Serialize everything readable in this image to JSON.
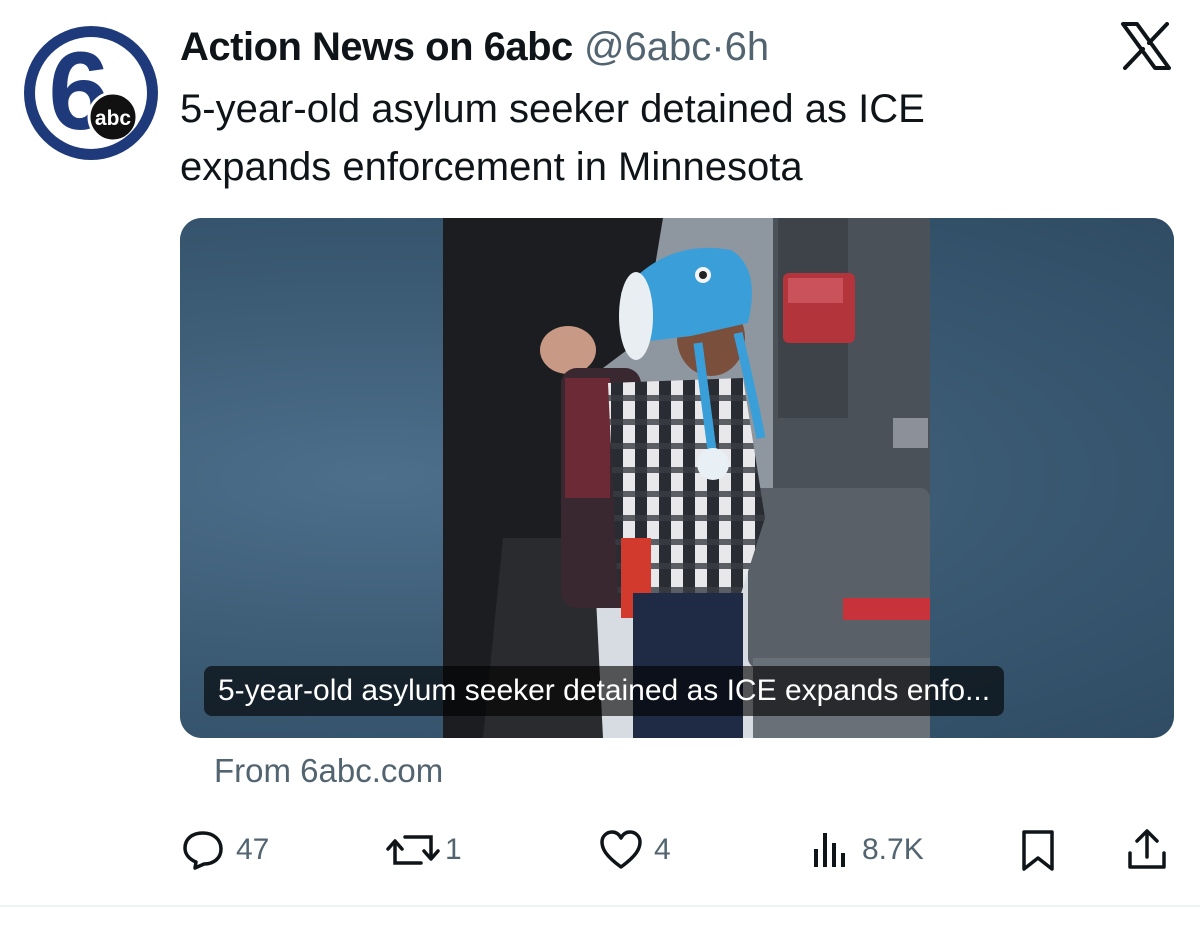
{
  "post": {
    "display_name": "Action News on 6abc",
    "handle": "@6abc",
    "separator": "·",
    "time": "6h",
    "headline": "5-year-old asylum seeker detained as ICE expands enforcement in Minnesota"
  },
  "avatar": {
    "logo_number": "6",
    "logo_text": "abc",
    "ring_color": "#1f3a7a"
  },
  "card": {
    "caption": "5-year-old asylum seeker detained as ICE expands enfo...",
    "source": "From 6abc.com"
  },
  "actions": {
    "replies": "47",
    "reposts": "1",
    "likes": "4",
    "views": "8.7K"
  },
  "icons": [
    "x-logo-icon",
    "reply-icon",
    "repost-icon",
    "like-icon",
    "views-icon",
    "bookmark-icon",
    "share-icon"
  ]
}
